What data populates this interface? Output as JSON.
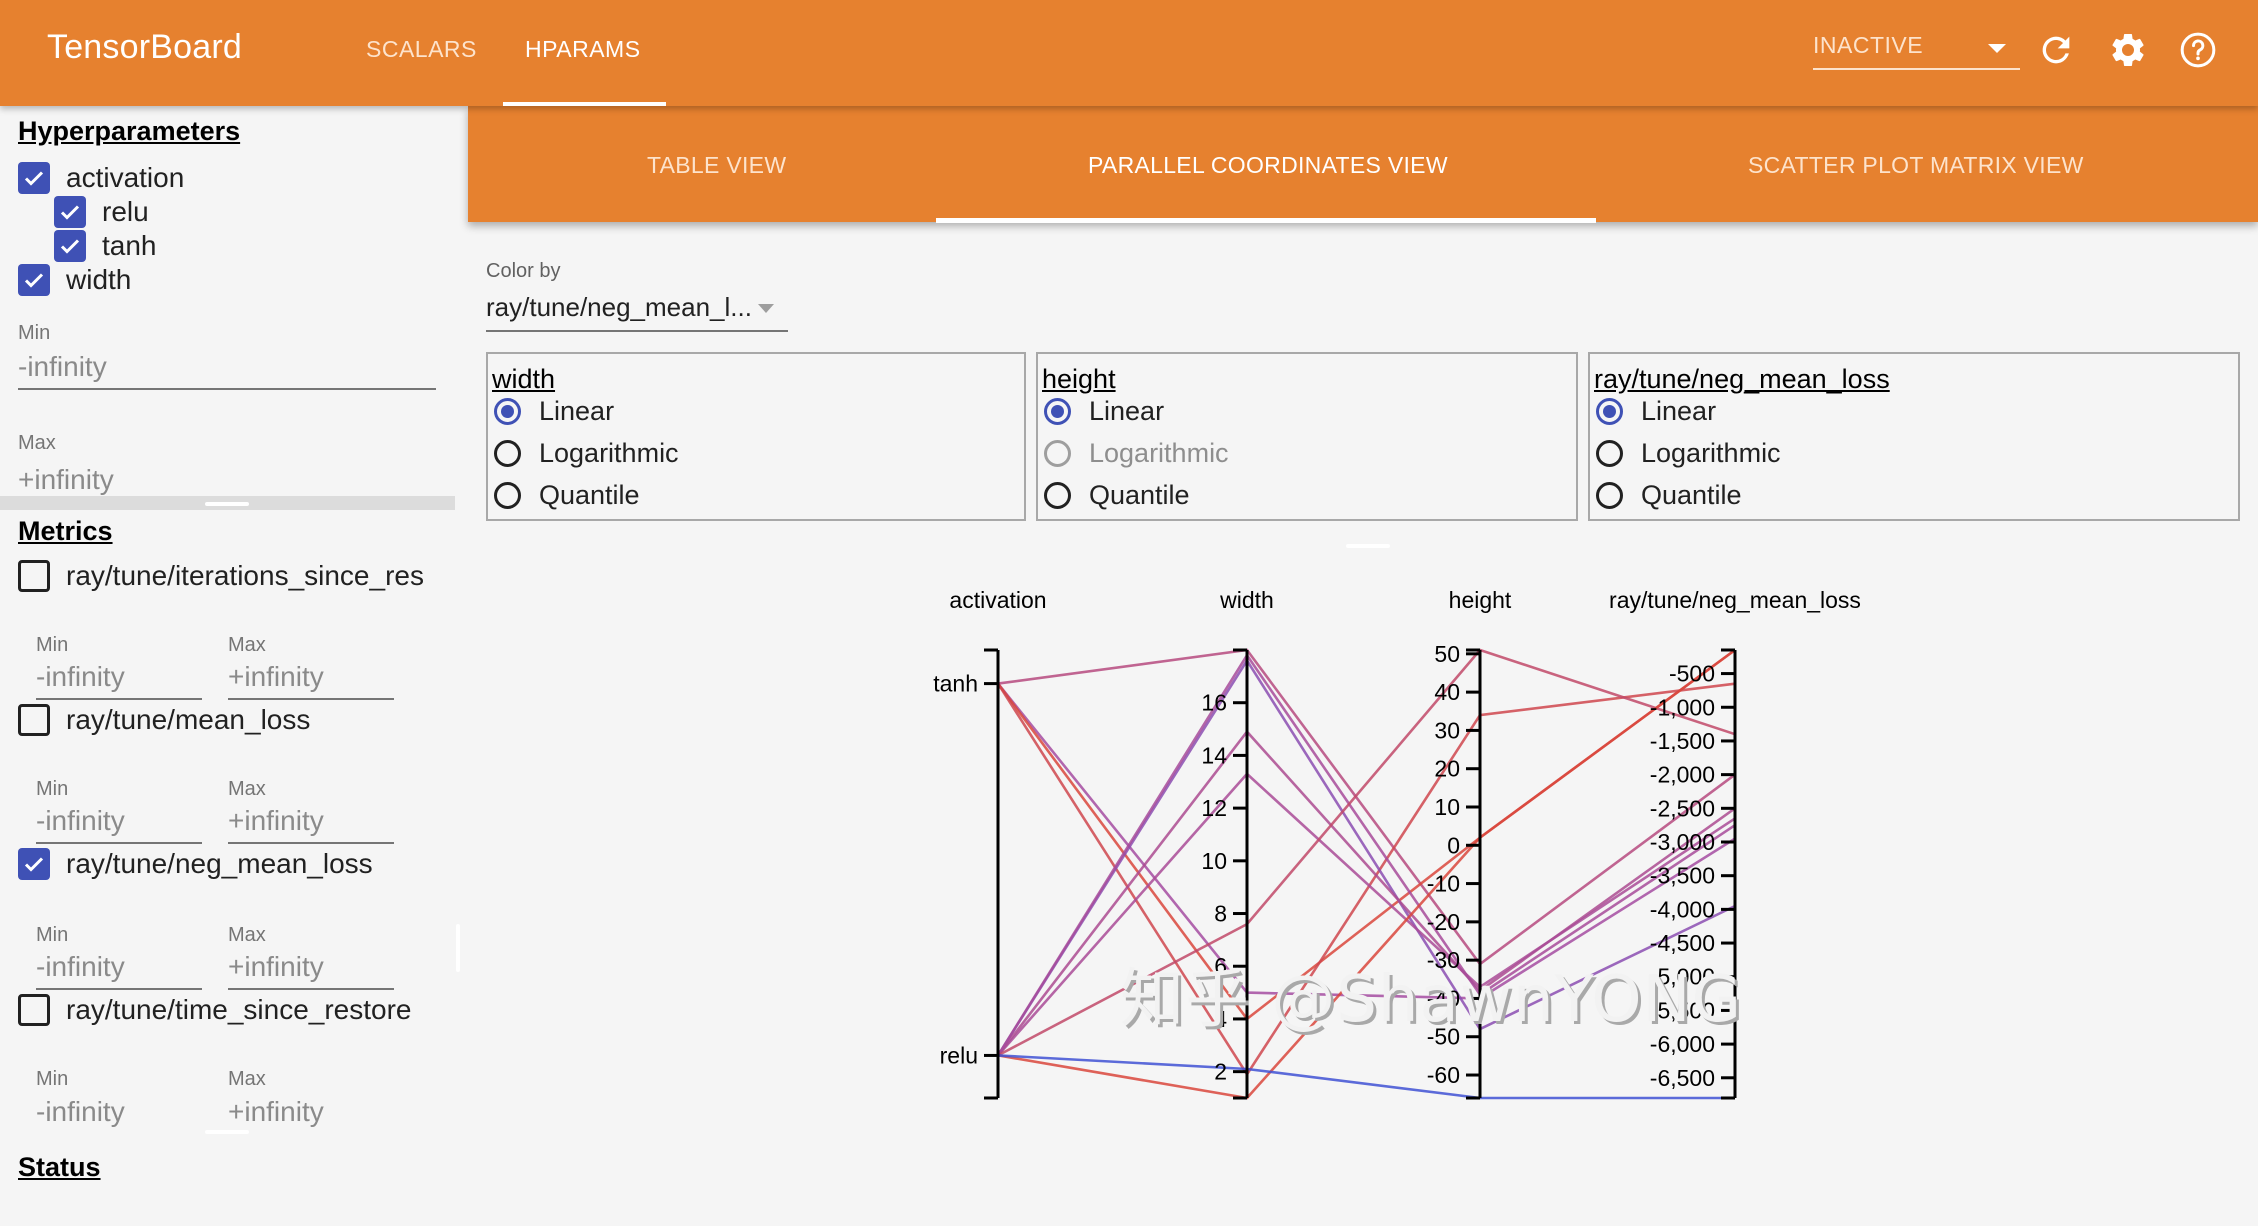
{
  "app": {
    "title": "TensorBoard"
  },
  "nav": {
    "tabs": [
      {
        "label": "SCALARS",
        "active": false
      },
      {
        "label": "HPARAMS",
        "active": true
      }
    ],
    "run_select": {
      "value": "INACTIVE"
    },
    "icons": [
      "refresh-icon",
      "settings-icon",
      "help-icon"
    ]
  },
  "sidebar": {
    "hyperparameters": {
      "title": "Hyperparameters",
      "items": [
        {
          "label": "activation",
          "checked": true,
          "level": 0
        },
        {
          "label": "relu",
          "checked": true,
          "level": 1
        },
        {
          "label": "tanh",
          "checked": true,
          "level": 1
        },
        {
          "label": "width",
          "checked": true,
          "level": 0
        }
      ],
      "width_min": {
        "label": "Min",
        "placeholder": "-infinity"
      },
      "width_max": {
        "label": "Max",
        "placeholder": "+infinity"
      }
    },
    "metrics": {
      "title": "Metrics",
      "items": [
        {
          "label": "ray/tune/iterations_since_res",
          "checked": false,
          "min_label": "Min",
          "min_placeholder": "-infinity",
          "max_label": "Max",
          "max_placeholder": "+infinity"
        },
        {
          "label": "ray/tune/mean_loss",
          "checked": false,
          "min_label": "Min",
          "min_placeholder": "-infinity",
          "max_label": "Max",
          "max_placeholder": "+infinity"
        },
        {
          "label": "ray/tune/neg_mean_loss",
          "checked": true,
          "min_label": "Min",
          "min_placeholder": "-infinity",
          "max_label": "Max",
          "max_placeholder": "+infinity"
        },
        {
          "label": "ray/tune/time_since_restore",
          "checked": false,
          "min_label": "Min",
          "min_placeholder": "-infinity",
          "max_label": "Max",
          "max_placeholder": "+infinity"
        }
      ]
    },
    "status": {
      "title": "Status"
    }
  },
  "views": {
    "tabs": [
      {
        "label": "TABLE VIEW",
        "active": false
      },
      {
        "label": "PARALLEL COORDINATES VIEW",
        "active": true
      },
      {
        "label": "SCATTER PLOT MATRIX VIEW",
        "active": false
      }
    ]
  },
  "options": {
    "color_by": {
      "label": "Color by",
      "value": "ray/tune/neg_mean_l..."
    },
    "scales": [
      {
        "title": "width",
        "options": [
          {
            "label": "Linear",
            "selected": true,
            "disabled": false
          },
          {
            "label": "Logarithmic",
            "selected": false,
            "disabled": false
          },
          {
            "label": "Quantile",
            "selected": false,
            "disabled": false
          }
        ]
      },
      {
        "title": "height",
        "options": [
          {
            "label": "Linear",
            "selected": true,
            "disabled": false
          },
          {
            "label": "Logarithmic",
            "selected": false,
            "disabled": true
          },
          {
            "label": "Quantile",
            "selected": false,
            "disabled": false
          }
        ]
      },
      {
        "title": "ray/tune/neg_mean_loss",
        "options": [
          {
            "label": "Linear",
            "selected": true,
            "disabled": false
          },
          {
            "label": "Logarithmic",
            "selected": false,
            "disabled": false
          },
          {
            "label": "Quantile",
            "selected": false,
            "disabled": false
          }
        ]
      }
    ]
  },
  "watermark": "知乎 @ShawnYONG",
  "chart_data": {
    "type": "parallel-coordinates",
    "title": "",
    "axes": [
      {
        "name": "activation",
        "kind": "categorical",
        "categories": [
          "tanh",
          "relu"
        ]
      },
      {
        "name": "width",
        "kind": "linear",
        "domain": [
          1,
          18
        ],
        "ticks": [
          2,
          4,
          6,
          8,
          10,
          12,
          14,
          16
        ]
      },
      {
        "name": "height",
        "kind": "linear",
        "domain": [
          -66,
          51
        ],
        "ticks": [
          50,
          40,
          30,
          20,
          10,
          0,
          -10,
          -20,
          -30,
          -40,
          -50,
          -60
        ]
      },
      {
        "name": "ray/tune/neg_mean_loss",
        "kind": "linear",
        "domain": [
          -6800,
          -150
        ],
        "ticks": [
          -500,
          -1000,
          -1500,
          -2000,
          -2500,
          -3000,
          -3500,
          -4000,
          -4500,
          -5000,
          -5500,
          -6000,
          -6500
        ],
        "tick_labels": [
          "-500",
          "-1,000",
          "-1,500",
          "-2,000",
          "-2,500",
          "-3,000",
          "-3,500",
          "-4,000",
          "-4,500",
          "-5,000",
          "-5,500",
          "-6,000",
          "-6,500"
        ]
      }
    ],
    "color_by": "ray/tune/neg_mean_loss",
    "color_scale": {
      "low": "#3f51d4",
      "mid": "#a04ca8",
      "high": "#d9463c"
    },
    "runs": [
      {
        "activation": "tanh",
        "width": 18.0,
        "height": -31,
        "neg_mean_loss": -2000
      },
      {
        "activation": "tanh",
        "width": 5.0,
        "height": -40,
        "neg_mean_loss": -2950
      },
      {
        "activation": "tanh",
        "width": 4.0,
        "height": 2,
        "neg_mean_loss": -150
      },
      {
        "activation": "tanh",
        "width": 1.9,
        "height": 34,
        "neg_mean_loss": -650
      },
      {
        "activation": "relu",
        "width": 17.6,
        "height": -48,
        "neg_mean_loss": -3950
      },
      {
        "activation": "relu",
        "width": 14.9,
        "height": -38,
        "neg_mean_loss": -2500
      },
      {
        "activation": "relu",
        "width": 13.3,
        "height": -37,
        "neg_mean_loss": -2650
      },
      {
        "activation": "relu",
        "width": 17.8,
        "height": -39,
        "neg_mean_loss": -2750
      },
      {
        "activation": "relu",
        "width": 7.6,
        "height": 51,
        "neg_mean_loss": -1400
      },
      {
        "activation": "relu",
        "width": 1.0,
        "height": 2,
        "neg_mean_loss": -150
      },
      {
        "activation": "relu",
        "width": 2.1,
        "height": -66,
        "neg_mean_loss": -6800
      }
    ]
  }
}
